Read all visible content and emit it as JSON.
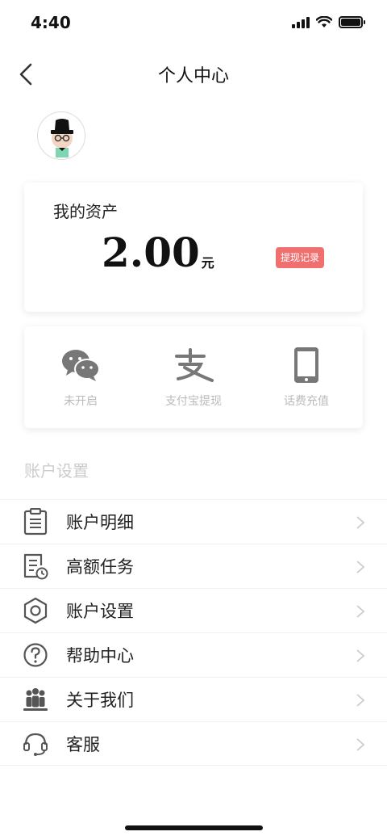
{
  "status_bar": {
    "time": "4:40"
  },
  "nav": {
    "title": "个人中心"
  },
  "assets": {
    "label": "我的资产",
    "value": "2.00",
    "unit": "元",
    "withdraw_record_label": "提现记录"
  },
  "payment_methods": [
    {
      "label": "未开启",
      "icon": "wechat-icon"
    },
    {
      "label": "支付宝提现",
      "icon": "alipay-icon"
    },
    {
      "label": "话费充值",
      "icon": "phone-icon"
    }
  ],
  "settings": {
    "title": "账户设置",
    "items": [
      {
        "label": "账户明细",
        "icon": "clipboard-icon"
      },
      {
        "label": "高额任务",
        "icon": "task-document-icon"
      },
      {
        "label": "账户设置",
        "icon": "hexagon-settings-icon"
      },
      {
        "label": "帮助中心",
        "icon": "help-icon"
      },
      {
        "label": "关于我们",
        "icon": "people-icon"
      },
      {
        "label": "客服",
        "icon": "headset-icon"
      }
    ]
  },
  "colors": {
    "accent": "#f07070",
    "muted_text": "#bbbbbb",
    "icon_gray": "#555555"
  }
}
